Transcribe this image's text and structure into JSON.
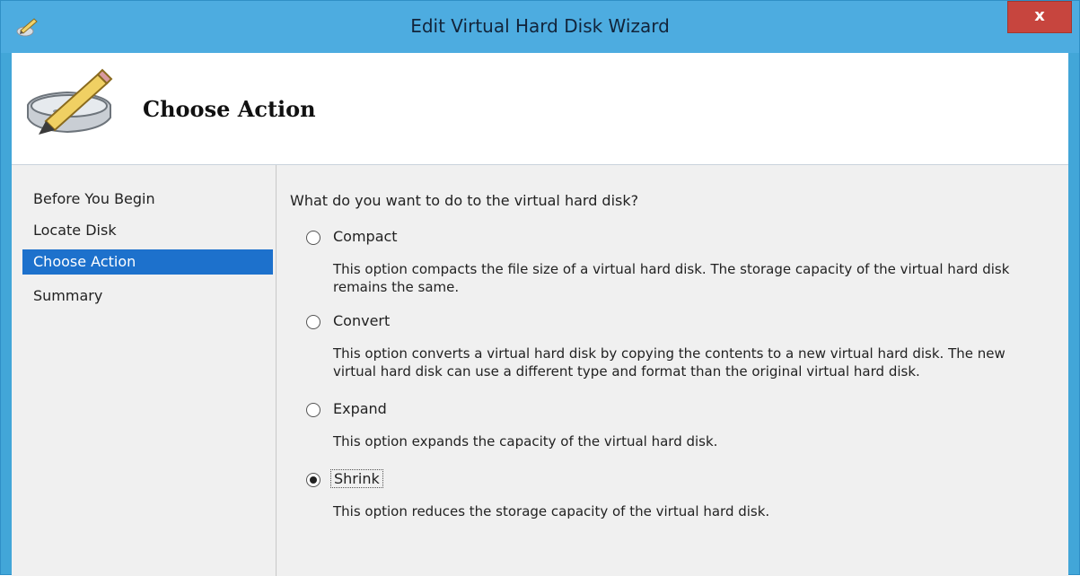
{
  "window": {
    "title": "Edit Virtual Hard Disk Wizard",
    "close_label": "x"
  },
  "header": {
    "title": "Choose Action"
  },
  "sidebar": {
    "steps": [
      {
        "label": "Before You Begin",
        "active": false
      },
      {
        "label": "Locate Disk",
        "active": false
      },
      {
        "label": "Choose Action",
        "active": true
      },
      {
        "label": "Summary",
        "active": false
      }
    ]
  },
  "content": {
    "question": "What do you want to do to the virtual hard disk?",
    "options": [
      {
        "label": "Compact",
        "selected": false,
        "description": "This option compacts the file size of a virtual hard disk. The storage capacity of the virtual hard disk remains the same."
      },
      {
        "label": "Convert",
        "selected": false,
        "description": "This option converts a virtual hard disk by copying the contents to a new virtual hard disk. The new virtual hard disk can use a different type and format than the original virtual hard disk."
      },
      {
        "label": "Expand",
        "selected": false,
        "description": "This option expands the capacity of the virtual hard disk."
      },
      {
        "label": "Shrink",
        "selected": true,
        "description": "This option reduces the storage capacity of the virtual hard disk."
      }
    ]
  },
  "colors": {
    "titlebar": "#4dace0",
    "selected_step": "#1d71cc",
    "close_button": "#c7453e"
  },
  "icons": {
    "title": "pencil-disk-icon",
    "header": "hard-disk-pencil-icon",
    "close": "close-icon"
  }
}
